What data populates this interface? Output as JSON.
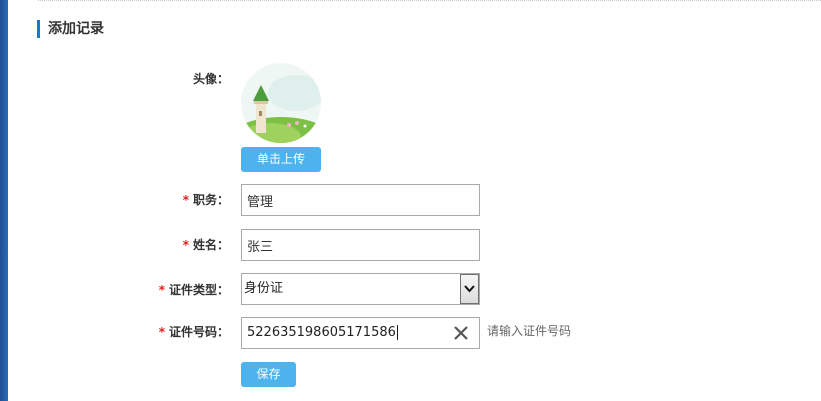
{
  "section": {
    "title": "添加记录"
  },
  "avatar": {
    "label": "头像：",
    "upload_label": "单击上传"
  },
  "form": {
    "required_mark": "*",
    "position": {
      "label": "职务：",
      "value": "管理"
    },
    "name": {
      "label": "姓名：",
      "value": "张三"
    },
    "id_type": {
      "label": "证件类型：",
      "selected": "身份证"
    },
    "id_number": {
      "label": "证件号码：",
      "value": "522635198605171586",
      "hint": "请输入证件号码"
    }
  },
  "actions": {
    "save_label": "保存"
  },
  "colors": {
    "accent": "#4db3ec",
    "required": "#e02020",
    "title_bar": "#1c78c4"
  }
}
